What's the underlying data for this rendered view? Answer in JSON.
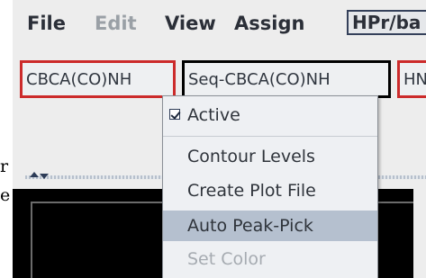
{
  "menubar": {
    "file": "File",
    "edit": "Edit",
    "view": "View",
    "assign": "Assign",
    "assign_combo_value": "HPr/ba"
  },
  "tabs": [
    {
      "label": "CBCA(CO)NH",
      "state": "selected"
    },
    {
      "label": "Seq-CBCA(CO)NH",
      "state": "context"
    },
    {
      "label": "HN",
      "state": "selected"
    }
  ],
  "context_menu": {
    "active_label": "Active",
    "active_checked": true,
    "items": [
      {
        "label": "Contour Levels",
        "enabled": true,
        "highlighted": false
      },
      {
        "label": "Create Plot File",
        "enabled": true,
        "highlighted": false
      },
      {
        "label": "Auto Peak-Pick",
        "enabled": true,
        "highlighted": true
      },
      {
        "label": "Set Color",
        "enabled": false,
        "highlighted": false
      }
    ]
  },
  "stray_text": {
    "line1": "r",
    "line2": "e"
  },
  "icons": {
    "expand_up": "triangle-up-icon",
    "expand_down": "triangle-down-icon",
    "check": "checkbox-check-icon"
  },
  "colors": {
    "selected_tab_border": "#cc2b2b",
    "context_tab_border": "#000000",
    "menu_highlight": "#b5c0cf",
    "plot_background": "#000000"
  }
}
